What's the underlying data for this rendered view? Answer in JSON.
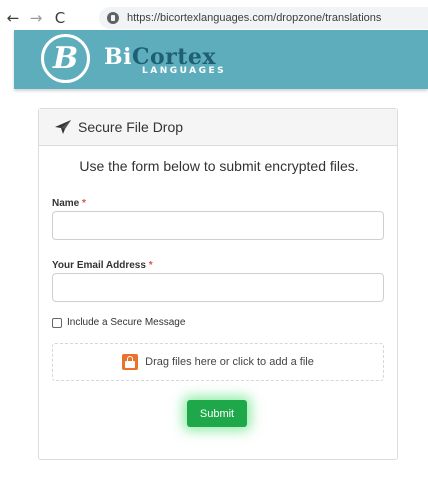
{
  "browser": {
    "back_glyph": "←",
    "forward_glyph": "→",
    "reload_glyph": "C",
    "url": "https://bicortexlanguages.com/dropzone/translations"
  },
  "header": {
    "logo_letter": "B",
    "brand_bi": "Bi",
    "brand_cortex": "Cortex",
    "brand_sub": "LANGUAGES",
    "color": "#5eadbd"
  },
  "card": {
    "title": "Secure File Drop",
    "intro": "Use the form below to submit encrypted files.",
    "name_label": "Name",
    "email_label": "Your Email Address",
    "required_mark": "*",
    "checkbox_label": "Include a Secure Message",
    "dropzone_text": "Drag files here or click to add a file",
    "submit_label": "Submit"
  },
  "colors": {
    "accent_green": "#1ea84a",
    "required_red": "#d9534f",
    "upload_orange": "#e8732a"
  }
}
